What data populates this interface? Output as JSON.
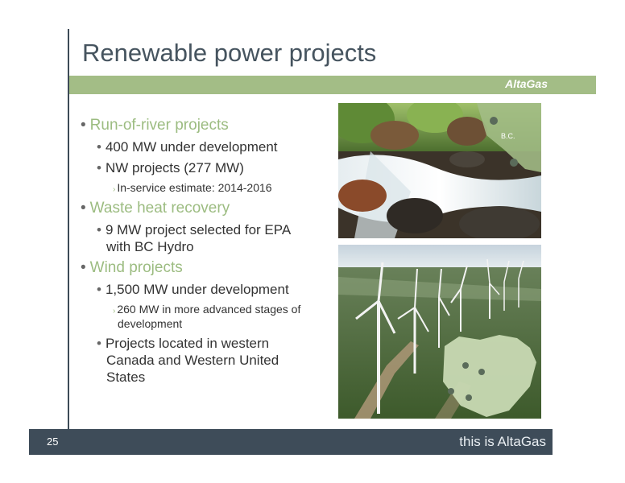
{
  "slide": {
    "title": "Renewable power projects",
    "brand": "AltaGas",
    "page_number": "25",
    "tagline": "this is AltaGas"
  },
  "bullets": {
    "run_of_river": "Run-of-river projects",
    "ror_1": "400 MW under development",
    "ror_2": "NW projects (277 MW)",
    "ror_2a": "In-service estimate: 2014-2016",
    "waste_heat": "Waste heat recovery",
    "wh_1a": "9 MW project selected for EPA",
    "wh_1b": "with BC Hydro",
    "wind": "Wind projects",
    "wind_1": "1,500 MW under development",
    "wind_1a_a": "260 MW in more advanced stages of",
    "wind_1a_b": "development",
    "wind_2a": "Projects located in western",
    "wind_2b": "Canada and Western United",
    "wind_2c": "States"
  },
  "images": {
    "map_bc_label": "B.C."
  },
  "colors": {
    "accent_green": "#a3bd86",
    "heading_green": "#9cbc81",
    "footer_slate": "#3e4c59",
    "title_gray": "#46545f"
  }
}
